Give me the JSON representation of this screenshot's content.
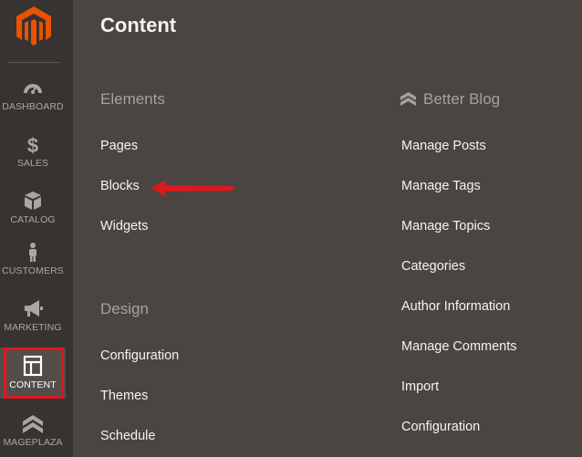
{
  "sidebar": {
    "items": [
      {
        "label": "DASHBOARD",
        "icon": "dashboard-icon"
      },
      {
        "label": "SALES",
        "icon": "dollar-icon"
      },
      {
        "label": "CATALOG",
        "icon": "box-icon"
      },
      {
        "label": "CUSTOMERS",
        "icon": "person-icon"
      },
      {
        "label": "MARKETING",
        "icon": "megaphone-icon"
      },
      {
        "label": "CONTENT",
        "icon": "layout-icon",
        "active": true
      },
      {
        "label": "MAGEPLAZA",
        "icon": "mageplaza-icon"
      }
    ]
  },
  "panel": {
    "title": "Content",
    "elements": {
      "title": "Elements",
      "links": [
        "Pages",
        "Blocks",
        "Widgets"
      ]
    },
    "design": {
      "title": "Design",
      "links": [
        "Configuration",
        "Themes",
        "Schedule"
      ]
    },
    "better_blog": {
      "title": "Better Blog",
      "links": [
        "Manage Posts",
        "Manage Tags",
        "Manage Topics",
        "Categories",
        "Author Information",
        "Manage Comments",
        "Import",
        "Configuration"
      ]
    }
  },
  "colors": {
    "sidebar_bg": "#373330",
    "panel_bg": "#4a4542",
    "logo_orange": "#eb5202",
    "highlight_red": "#e0161d",
    "link_text": "#f7f3eb",
    "muted_text": "#a6a19b"
  }
}
